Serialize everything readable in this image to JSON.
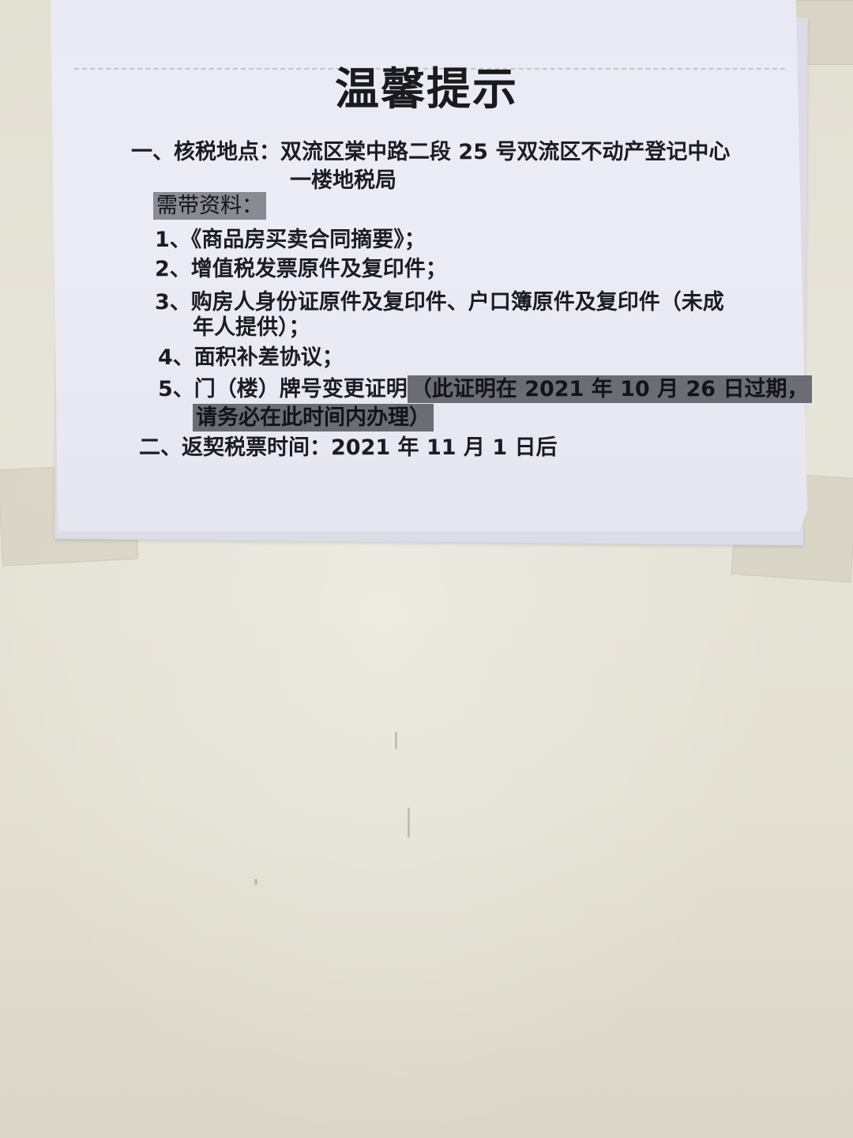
{
  "notice": {
    "title": "温馨提示",
    "section1": {
      "line1": "一、核税地点：双流区棠中路二段 25 号双流区不动产登记中心",
      "line2": "一楼地税局"
    },
    "required_label": "需带资料：",
    "items": [
      {
        "text": "1、《商品房买卖合同摘要》；"
      },
      {
        "text": "2、增值税发票原件及复印件；"
      },
      {
        "text": "3、购房人身份证原件及复印件、户口簿原件及复印件（未成",
        "text_cont": "年人提供）；"
      },
      {
        "text": "4、面积补差协议；"
      },
      {
        "text": "5、门（楼）牌号变更证明",
        "note": "（此证明在 2021 年 10 月 26 日过期，",
        "note_cont": "请务必在此时间内办理）"
      }
    ],
    "section2": "二、返契税票时间：2021 年 11 月 1 日后"
  }
}
